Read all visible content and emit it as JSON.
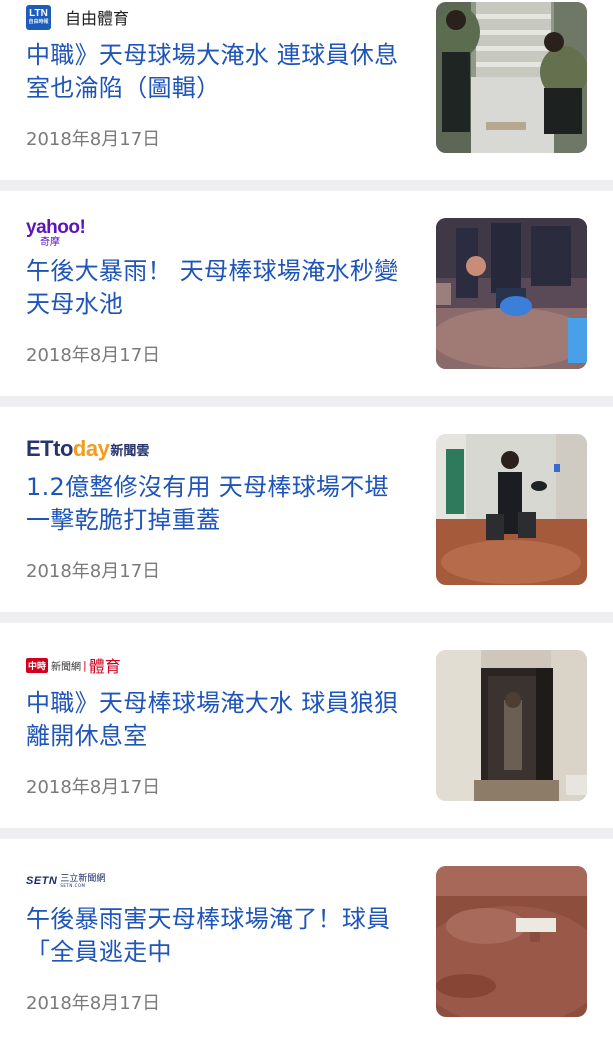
{
  "articles": [
    {
      "source": {
        "name": "自由體育",
        "badge_top": "LTN",
        "badge_bottom": "自由時報"
      },
      "title": "中職》天母球場大淹水 連球員休息室也淪陷（圖輯）",
      "date": "2018年8月17日",
      "thumbnail": "stairs-flood-photo"
    },
    {
      "source": {
        "logo_word": "yahoo!",
        "logo_sub": "奇摩"
      },
      "title": "午後大暴雨！ 天母棒球場淹水秒變天母水池",
      "date": "2018年8月17日",
      "thumbnail": "bailing-water-photo"
    },
    {
      "source": {
        "logo_word_a": "ETto",
        "logo_word_b": "day",
        "logo_sub": "新聞雲"
      },
      "title": "1.2億整修沒有用 天母棒球場不堪一擊乾脆打掉重蓋",
      "date": "2018年8月17日",
      "thumbnail": "player-carrying-bags-photo"
    },
    {
      "source": {
        "logo_badge": "中時",
        "logo_net": "新聞網",
        "logo_sep": "|",
        "logo_section": "體育"
      },
      "title": "中職》天母棒球場淹大水 球員狼狽離開休息室",
      "date": "2018年8月17日",
      "thumbnail": "doorway-flood-photo"
    },
    {
      "source": {
        "logo_word": "SETN",
        "logo_cn": "三立新聞網",
        "logo_domain": "SETN.COM"
      },
      "title": "午後暴雨害天母棒球場淹了！球員「全員逃走中",
      "date": "2018年8月17日",
      "thumbnail": "flooded-field-photo"
    }
  ],
  "colors": {
    "headline": "#1f55b8",
    "date": "#7a7a7a",
    "separator": "#eeeef0",
    "card": "#ffffff"
  }
}
